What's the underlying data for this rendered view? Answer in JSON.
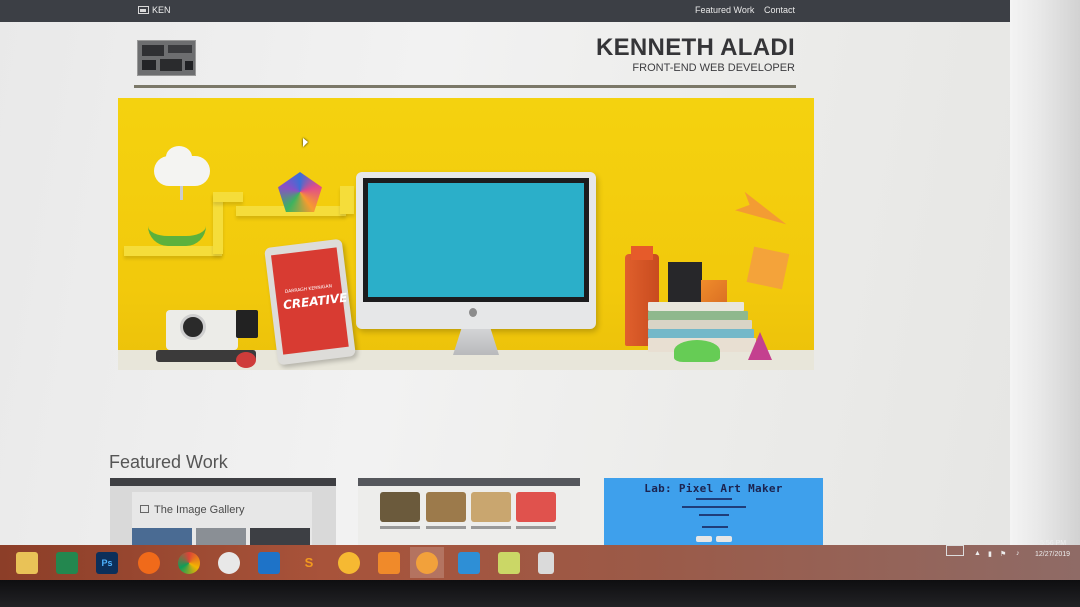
{
  "navbar": {
    "brand": "KEN",
    "links": [
      "Featured Work",
      "Contact"
    ]
  },
  "header": {
    "name": "KENNETH ALADI",
    "subtitle": "FRONT-END WEB DEVELOPER"
  },
  "hero": {
    "tablet_small_text": "DARRAGH KERNIGAN",
    "tablet_big_text": "CREATIVE"
  },
  "featured": {
    "title": "Featured Work",
    "cards": [
      {
        "title": "The Image Gallery"
      },
      {
        "title": ""
      },
      {
        "title": "Lab: Pixel Art Maker"
      }
    ]
  },
  "taskbar": {
    "time": "5:56 PM",
    "date": "12/27/2019",
    "apps": [
      "file-explorer-icon",
      "excel-icon",
      "photoshop-icon",
      "firefox-icon",
      "chrome-icon",
      "spotify-icon",
      "vscode-icon",
      "sublime-icon",
      "chrome-canary-icon",
      "media-player-icon",
      "coreldraw-icon",
      "teamviewer-icon",
      "files-icon",
      "notepad-icon"
    ]
  },
  "colors": {
    "navbar": "#3c3f45",
    "hero_yellow": "#f4d20f",
    "display_cyan": "#2bafc9",
    "pixel_art_card": "#3ea0ec",
    "taskbar": "#a8533a"
  }
}
